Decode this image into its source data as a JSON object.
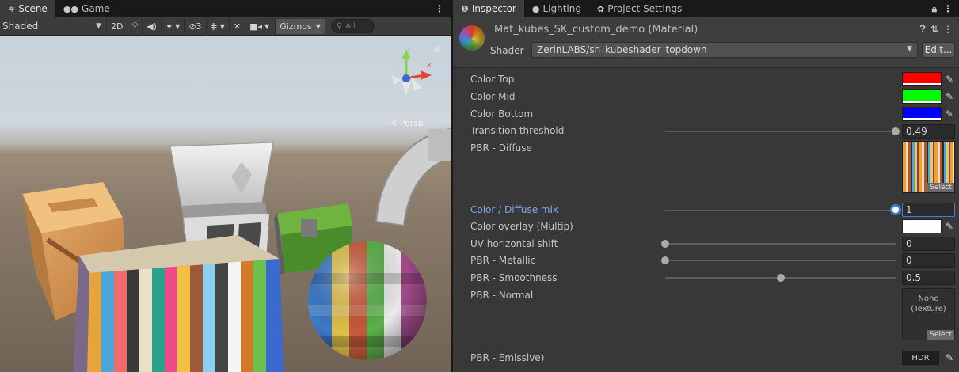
{
  "scene_panel": {
    "tabs": [
      {
        "label": "Scene",
        "icon": "grid-icon"
      },
      {
        "label": "Game",
        "icon": "gamepad-icon"
      }
    ],
    "toolbar": {
      "shading_mode": "Shaded",
      "mode_2d": "2D",
      "hidden_count": "3",
      "gizmos_label": "Gizmos",
      "search_placeholder": "All"
    },
    "viewport": {
      "gizmo_axis_y": "y",
      "gizmo_axis_x": "x",
      "projection_label": "Persp"
    }
  },
  "inspector_panel": {
    "tabs": [
      {
        "label": "Inspector",
        "icon": "info-icon"
      },
      {
        "label": "Lighting",
        "icon": "bulb-icon"
      },
      {
        "label": "Project Settings",
        "icon": "gear-icon"
      }
    ],
    "material_title": "Mat_kubes_SK_custom_demo (Material)",
    "shader_label": "Shader",
    "shader_value": "ZerinLABS/sh_kubeshader_topdown",
    "edit_label": "Edit...",
    "properties": {
      "color_top": {
        "label": "Color Top",
        "color": "#ff0000"
      },
      "color_mid": {
        "label": "Color Mid",
        "color": "#00ff00"
      },
      "color_bottom": {
        "label": "Color Bottom",
        "color": "#0000ff"
      },
      "transition_threshold": {
        "label": "Transition threshold",
        "value": "0.49",
        "fraction": 1.0
      },
      "pbr_diffuse": {
        "label": "PBR - Diffuse",
        "select_label": "Select"
      },
      "color_diffuse_mix": {
        "label": "Color / Diffuse mix",
        "value": "1",
        "fraction": 1.0
      },
      "color_overlay": {
        "label": "Color overlay (Multip)",
        "color": "#ffffff"
      },
      "uv_horizontal_shift": {
        "label": "UV horizontal shift",
        "value": "0",
        "fraction": 0.0
      },
      "pbr_metallic": {
        "label": "PBR - Metallic",
        "value": "0",
        "fraction": 0.0
      },
      "pbr_smoothness": {
        "label": "PBR - Smoothness",
        "value": "0.5",
        "fraction": 0.5
      },
      "pbr_normal": {
        "label": "PBR - Normal",
        "texture_line1": "None",
        "texture_line2": "(Texture)",
        "select_label": "Select"
      },
      "pbr_emissive": {
        "label": "PBR - Emissive)",
        "hdr_label": "HDR"
      }
    }
  }
}
